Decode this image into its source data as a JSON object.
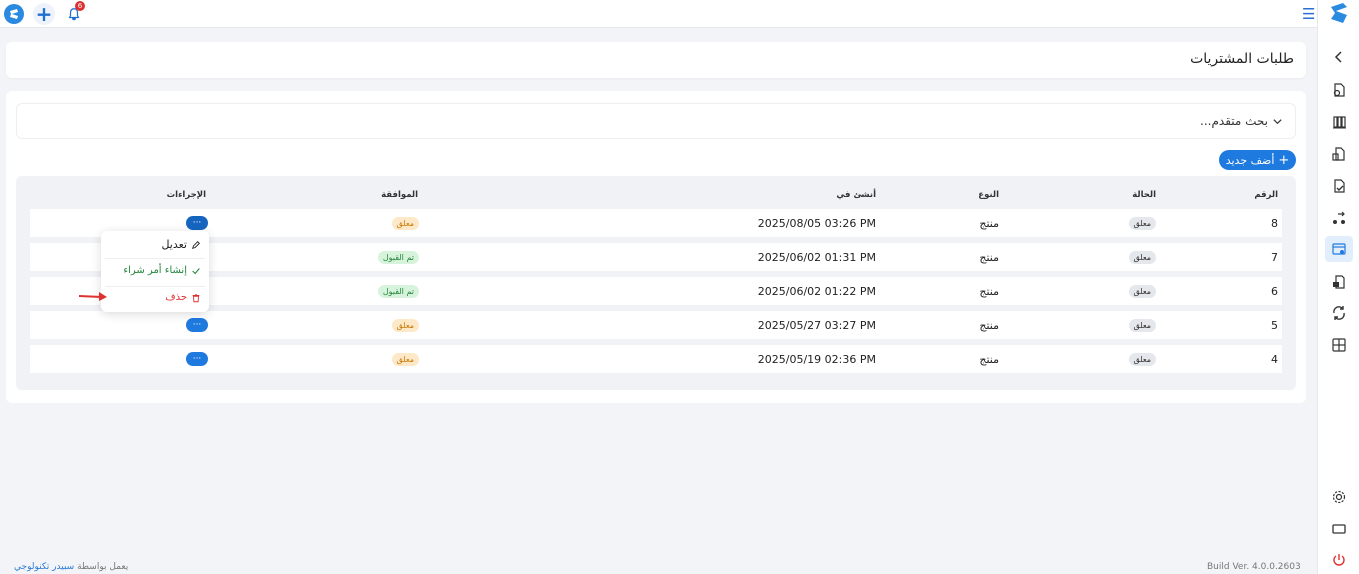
{
  "topbar": {
    "notification_count": "6"
  },
  "page": {
    "title": "طلبات المشتريات"
  },
  "search": {
    "label": "بحث متقدم..."
  },
  "add_button": {
    "label": "أضف جديد"
  },
  "table": {
    "headers": {
      "number": "الرقم",
      "status": "الحالة",
      "type": "النوع",
      "created_at": "أنشئ في",
      "approval": "الموافقة",
      "actions": "الإجراءات"
    },
    "rows": [
      {
        "number": "8",
        "status": "معلق",
        "type": "منتج",
        "created_at": "2025/08/05 03:26 PM",
        "approval": "معلق",
        "approval_state": "pending",
        "actions": "···"
      },
      {
        "number": "7",
        "status": "معلق",
        "type": "منتج",
        "created_at": "2025/06/02 01:31 PM",
        "approval": "تم القبول",
        "approval_state": "accepted",
        "actions": "···"
      },
      {
        "number": "6",
        "status": "معلق",
        "type": "منتج",
        "created_at": "2025/06/02 01:22 PM",
        "approval": "تم القبول",
        "approval_state": "accepted",
        "actions": "···"
      },
      {
        "number": "5",
        "status": "معلق",
        "type": "منتج",
        "created_at": "2025/05/27 03:27 PM",
        "approval": "معلق",
        "approval_state": "pending",
        "actions": "···"
      },
      {
        "number": "4",
        "status": "معلق",
        "type": "منتج",
        "created_at": "2025/05/19 02:36 PM",
        "approval": "معلق",
        "approval_state": "pending",
        "actions": "···"
      }
    ]
  },
  "dropdown": {
    "items": [
      {
        "label": "تعديل",
        "icon": "pencil-icon"
      },
      {
        "label": "إنشاء أمر شراء",
        "icon": "check-icon"
      },
      {
        "label": "حذف",
        "icon": "trash-icon"
      }
    ]
  },
  "footer": {
    "powered_by": "يعمل بواسطة",
    "company": "سبيدر تكنولوجي",
    "build": "Build Ver. 4.0.0.2603"
  },
  "colors": {
    "primary": "#1f7ae0",
    "pending_bg": "#fde9c8",
    "pending_text": "#c77a0a",
    "accepted_bg": "#d8f3dc",
    "accepted_text": "#22863a",
    "danger": "#e03131"
  }
}
